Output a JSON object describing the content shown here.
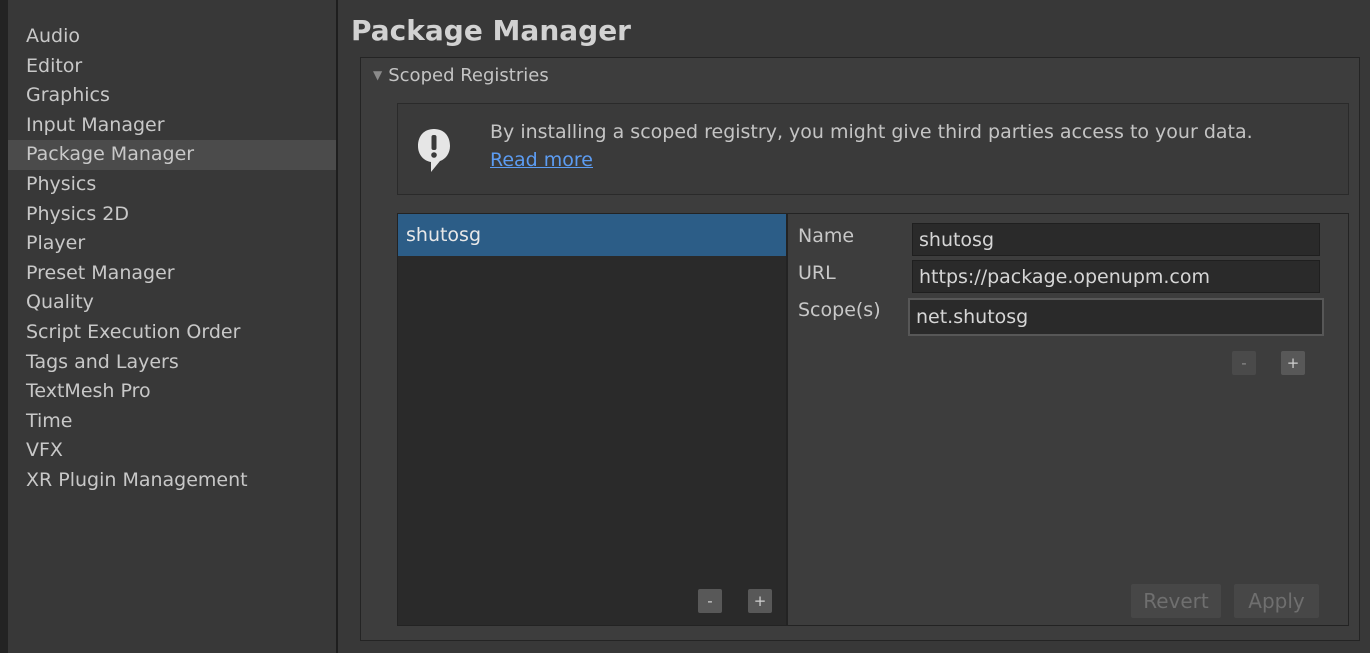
{
  "sidebar": {
    "items": [
      {
        "label": "Audio"
      },
      {
        "label": "Editor"
      },
      {
        "label": "Graphics"
      },
      {
        "label": "Input Manager"
      },
      {
        "label": "Package Manager"
      },
      {
        "label": "Physics"
      },
      {
        "label": "Physics 2D"
      },
      {
        "label": "Player"
      },
      {
        "label": "Preset Manager"
      },
      {
        "label": "Quality"
      },
      {
        "label": "Script Execution Order"
      },
      {
        "label": "Tags and Layers"
      },
      {
        "label": "TextMesh Pro"
      },
      {
        "label": "Time"
      },
      {
        "label": "VFX"
      },
      {
        "label": "XR Plugin Management"
      }
    ],
    "active_index": 4
  },
  "main": {
    "title": "Package Manager",
    "section": {
      "label": "Scoped Registries",
      "expanded": true
    },
    "help": {
      "icon": "warning-speech-bubble-icon",
      "text": "By installing a scoped registry, you might give third parties access to your data.",
      "link": "Read more"
    },
    "registry_list": {
      "items": [
        "shutosg"
      ],
      "remove_label": "-",
      "add_label": "+"
    },
    "details": {
      "name_label": "Name",
      "name_value": "shutosg",
      "url_label": "URL",
      "url_value": "https://package.openupm.com",
      "scopes_label": "Scope(s)",
      "scope_value": "net.shutosg",
      "scope_remove_label": "-",
      "scope_add_label": "+",
      "revert_label": "Revert",
      "apply_label": "Apply"
    }
  },
  "colors": {
    "background": "#383838",
    "selection": "#2c5d87",
    "link": "#5c9cf2",
    "list_background": "#2a2a2a"
  }
}
